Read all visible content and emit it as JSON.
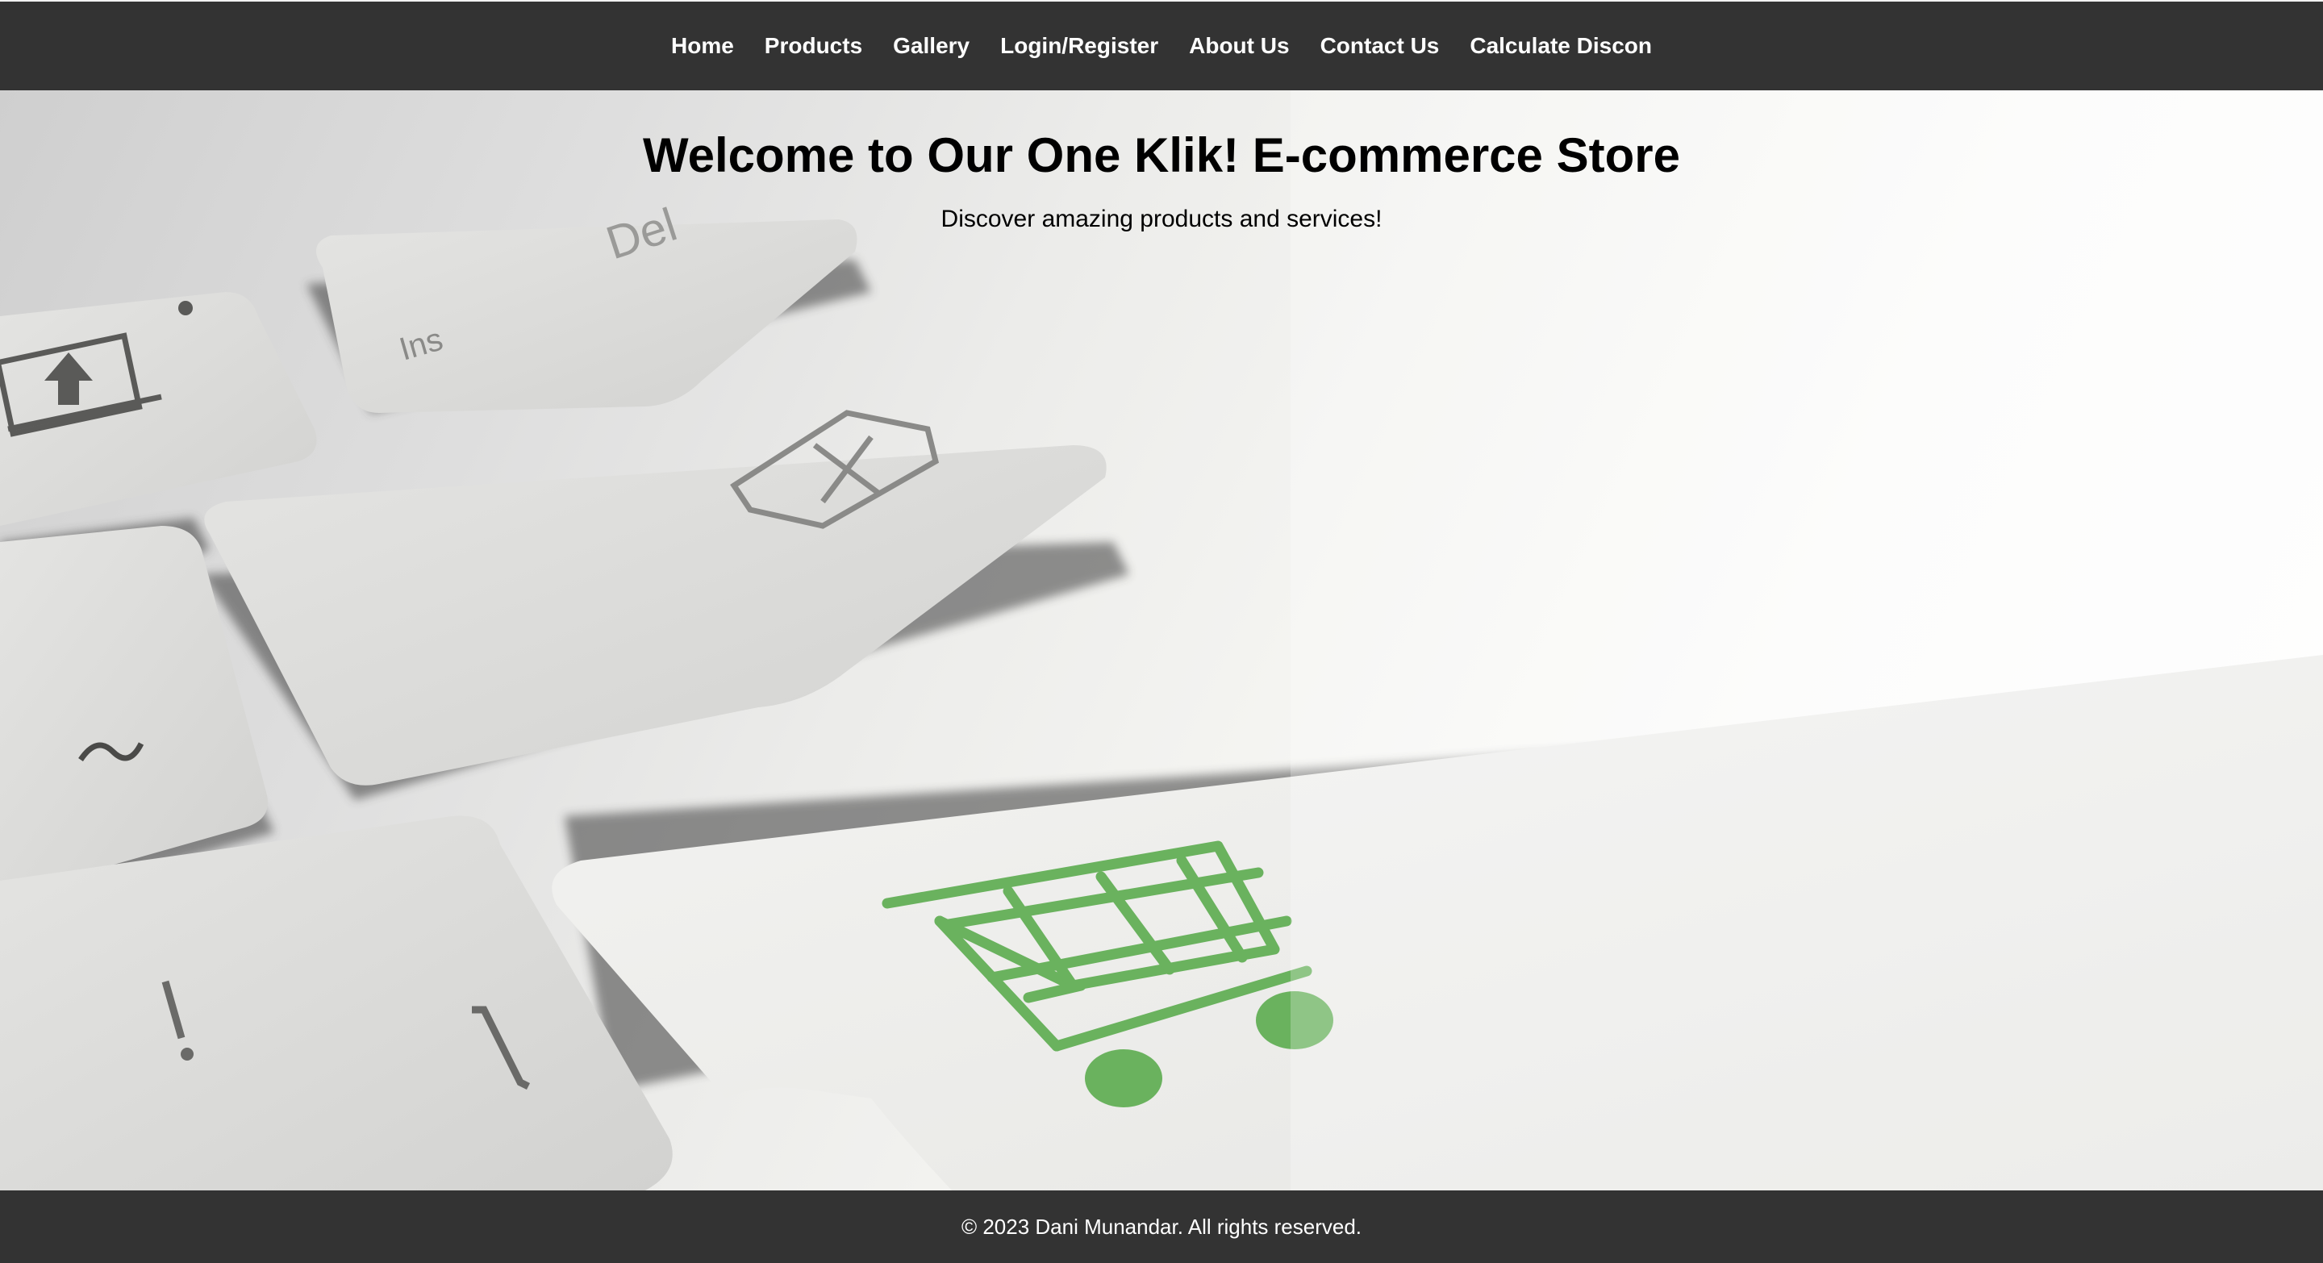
{
  "nav": {
    "items": [
      {
        "label": "Home"
      },
      {
        "label": "Products"
      },
      {
        "label": "Gallery"
      },
      {
        "label": "Login/Register"
      },
      {
        "label": "About Us"
      },
      {
        "label": "Contact Us"
      },
      {
        "label": "Calculate Discon"
      }
    ]
  },
  "hero": {
    "title": "Welcome to Our One Klik! E-commerce Store",
    "subtitle": "Discover amazing products and services!",
    "background_icon": "shopping-cart-icon",
    "cart_color": "#6ab25e"
  },
  "footer": {
    "text": "© 2023 Dani Munandar. All rights reserved."
  },
  "colors": {
    "nav_bg": "#333333",
    "footer_bg": "#333333",
    "nav_text": "#ffffff"
  }
}
